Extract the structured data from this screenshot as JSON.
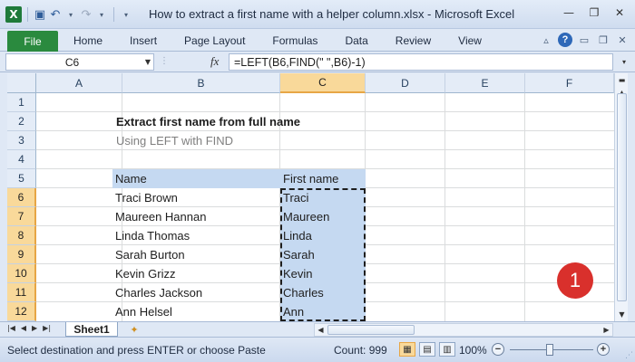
{
  "window": {
    "title": "How to extract a first name with a helper column.xlsx - Microsoft Excel",
    "app_letter": "X"
  },
  "ribbon": {
    "file_label": "File",
    "tabs": [
      "Home",
      "Insert",
      "Page Layout",
      "Formulas",
      "Data",
      "Review",
      "View"
    ]
  },
  "formula_bar": {
    "name_box": "C6",
    "fx_label": "fx",
    "formula": "=LEFT(B6,FIND(\" \",B6)-1)"
  },
  "grid": {
    "columns": [
      "A",
      "B",
      "C",
      "D",
      "E",
      "F"
    ],
    "selected_column": "C",
    "rows": [
      "1",
      "2",
      "3",
      "4",
      "5",
      "6",
      "7",
      "8",
      "9",
      "10",
      "11",
      "12"
    ],
    "selected_rows": [
      "6",
      "7",
      "8",
      "9",
      "10",
      "11",
      "12"
    ],
    "title": "Extract first name from full name",
    "subtitle": "Using LEFT with FIND",
    "table_headers": {
      "name": "Name",
      "first_name": "First name"
    },
    "table_rows": [
      {
        "name": "Traci Brown",
        "first": "Traci"
      },
      {
        "name": "Maureen Hannan",
        "first": "Maureen"
      },
      {
        "name": "Linda Thomas",
        "first": "Linda"
      },
      {
        "name": "Sarah Burton",
        "first": "Sarah"
      },
      {
        "name": "Kevin Grizz",
        "first": "Kevin"
      },
      {
        "name": "Charles Jackson",
        "first": "Charles"
      },
      {
        "name": "Ann Helsel",
        "first": "Ann"
      }
    ],
    "badge": "1"
  },
  "sheets": {
    "active": "Sheet1"
  },
  "status_bar": {
    "message": "Select destination and press ENTER or choose Paste",
    "count": "Count: 999",
    "zoom": "100%"
  },
  "colors": {
    "accent_green": "#2a8a3e",
    "selection_header": "#f9d99a",
    "table_fill": "#c5d9f1",
    "badge_red": "#d9302c"
  }
}
